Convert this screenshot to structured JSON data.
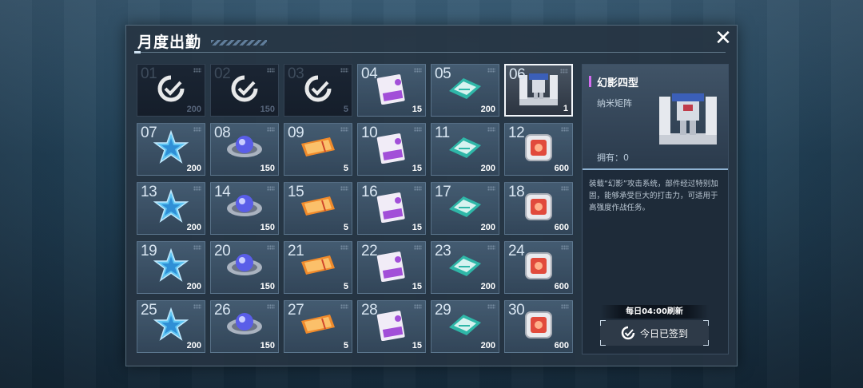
{
  "window": {
    "title": "月度出勤",
    "close_symbol": "✕"
  },
  "rewards": [
    {
      "day": "01",
      "qty": "200",
      "state": "claimed",
      "icon": "check-icon"
    },
    {
      "day": "02",
      "qty": "150",
      "state": "claimed",
      "icon": "check-icon"
    },
    {
      "day": "03",
      "qty": "5",
      "state": "claimed",
      "icon": "check-icon"
    },
    {
      "day": "04",
      "qty": "15",
      "state": "normal",
      "icon": "purple-chip-icon"
    },
    {
      "day": "05",
      "qty": "200",
      "state": "normal",
      "icon": "teal-ticket-icon"
    },
    {
      "day": "06",
      "qty": "1",
      "state": "selected",
      "icon": "mech-figure-icon"
    },
    {
      "day": "07",
      "qty": "200",
      "state": "normal",
      "icon": "blue-star-crystal-icon"
    },
    {
      "day": "08",
      "qty": "150",
      "state": "normal",
      "icon": "energy-orb-icon"
    },
    {
      "day": "09",
      "qty": "5",
      "state": "normal",
      "icon": "orange-ticket-icon"
    },
    {
      "day": "10",
      "qty": "15",
      "state": "normal",
      "icon": "purple-chip-icon"
    },
    {
      "day": "11",
      "qty": "200",
      "state": "normal",
      "icon": "teal-ticket-icon"
    },
    {
      "day": "12",
      "qty": "600",
      "state": "normal",
      "icon": "red-cube-icon"
    },
    {
      "day": "13",
      "qty": "200",
      "state": "normal",
      "icon": "blue-star-crystal-icon"
    },
    {
      "day": "14",
      "qty": "150",
      "state": "normal",
      "icon": "energy-orb-icon"
    },
    {
      "day": "15",
      "qty": "5",
      "state": "normal",
      "icon": "orange-ticket-icon"
    },
    {
      "day": "16",
      "qty": "15",
      "state": "normal",
      "icon": "purple-chip-icon"
    },
    {
      "day": "17",
      "qty": "200",
      "state": "normal",
      "icon": "teal-ticket-icon"
    },
    {
      "day": "18",
      "qty": "600",
      "state": "normal",
      "icon": "red-cube-icon"
    },
    {
      "day": "19",
      "qty": "200",
      "state": "normal",
      "icon": "blue-star-crystal-icon"
    },
    {
      "day": "20",
      "qty": "150",
      "state": "normal",
      "icon": "energy-orb-icon"
    },
    {
      "day": "21",
      "qty": "5",
      "state": "normal",
      "icon": "orange-ticket-icon"
    },
    {
      "day": "22",
      "qty": "15",
      "state": "normal",
      "icon": "purple-chip-icon"
    },
    {
      "day": "23",
      "qty": "200",
      "state": "normal",
      "icon": "teal-ticket-icon"
    },
    {
      "day": "24",
      "qty": "600",
      "state": "normal",
      "icon": "red-cube-icon"
    },
    {
      "day": "25",
      "qty": "200",
      "state": "normal",
      "icon": "blue-star-crystal-icon"
    },
    {
      "day": "26",
      "qty": "150",
      "state": "normal",
      "icon": "energy-orb-icon"
    },
    {
      "day": "27",
      "qty": "5",
      "state": "normal",
      "icon": "orange-ticket-icon"
    },
    {
      "day": "28",
      "qty": "15",
      "state": "normal",
      "icon": "purple-chip-icon"
    },
    {
      "day": "29",
      "qty": "200",
      "state": "normal",
      "icon": "teal-ticket-icon"
    },
    {
      "day": "30",
      "qty": "600",
      "state": "normal",
      "icon": "red-cube-icon"
    }
  ],
  "detail": {
    "item_name": "幻影四型",
    "item_category": "纳米矩阵",
    "owned_label": "拥有：0",
    "description": "装载“幻影”攻击系统，部件经过特别加固，能够承受巨大的打击力，可适用于高强度作战任务。",
    "refresh_note": "每日04:00刷新",
    "signed_label": "今日已签到",
    "signed_icon": "check-icon"
  },
  "colors": {
    "accent_purple": "#d46cf0",
    "accent_line": "#8fb3d3"
  }
}
